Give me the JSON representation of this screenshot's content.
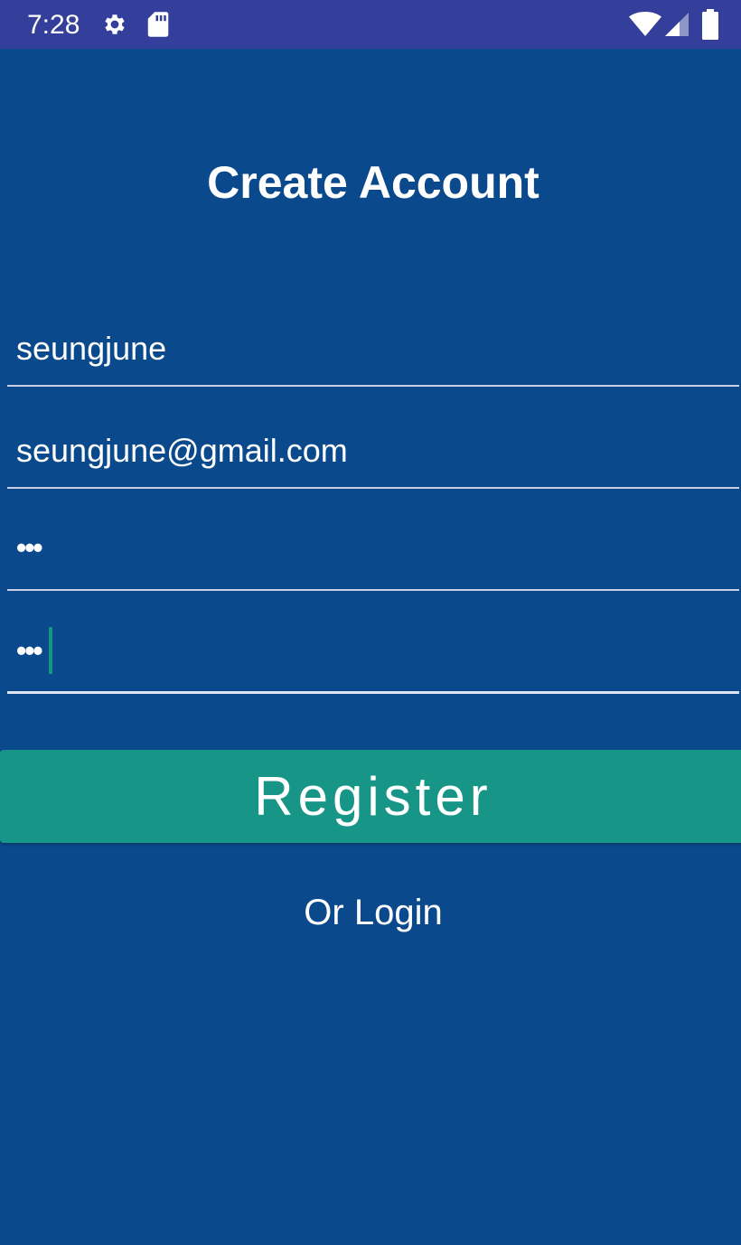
{
  "status_bar": {
    "time": "7:28",
    "icons": [
      "gear-icon",
      "sd-card-icon",
      "wifi-icon",
      "signal-icon",
      "battery-icon"
    ]
  },
  "title": "Create Account",
  "form": {
    "username_value": "seungjune",
    "email_value": "seungjune@gmail.com",
    "password_value": "•••",
    "confirm_password_value": "•••"
  },
  "register_label": "Register",
  "login_link_label": "Or Login",
  "colors": {
    "background": "#0a4a8c",
    "status_bar": "#333f9a",
    "accent": "#179687",
    "text": "#ffffff"
  }
}
